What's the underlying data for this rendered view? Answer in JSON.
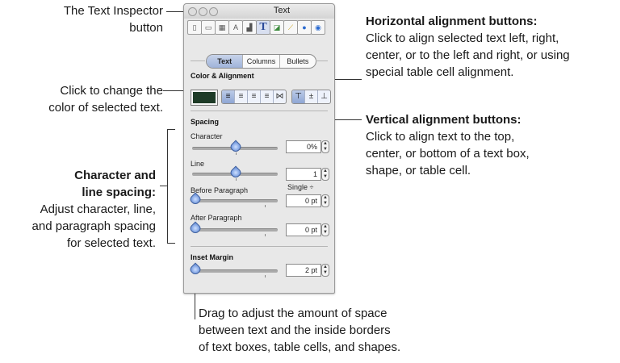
{
  "annotations": {
    "inspector_button": [
      "The Text Inspector",
      "button"
    ],
    "color": [
      "Click to change the",
      "color of selected text."
    ],
    "spacing_heading": [
      "Character and",
      "line spacing:"
    ],
    "spacing_body": [
      "Adjust character, line,",
      "and paragraph spacing",
      "for selected text."
    ],
    "horizontal_heading": "Horizontal alignment buttons:",
    "horizontal_body": [
      "Click to align selected text left, right,",
      "center, or to the left and right, or using",
      "special table cell alignment."
    ],
    "vertical_heading": "Vertical alignment buttons:",
    "vertical_body": [
      "Click to align text to the top,",
      "center, or bottom of a text box,",
      "shape, or table cell."
    ],
    "inset_body": [
      "Drag to adjust the amount of space",
      "between text and the inside borders",
      "of text boxes, table cells, and shapes."
    ]
  },
  "panel": {
    "title": "Text",
    "tabs": [
      "Text",
      "Columns",
      "Bullets"
    ],
    "color_alignment_label": "Color & Alignment",
    "text_color": "#1e3b27",
    "horizontal_buttons": [
      "≡",
      "≡",
      "≡",
      "≡",
      "⋈"
    ],
    "vertical_buttons": [
      "⊤",
      "±",
      "⊥"
    ],
    "spacing_label": "Spacing",
    "character_label": "Character",
    "character_value": "0%",
    "line_label": "Line",
    "line_value": "1",
    "line_mode": "Single ÷",
    "before_label": "Before Paragraph",
    "before_value": "0 pt",
    "after_label": "After Paragraph",
    "after_value": "0 pt",
    "inset_label": "Inset Margin",
    "inset_value": "2 pt",
    "toolbar_icons": [
      "document-icon",
      "layout-icon",
      "table-icon",
      "ai-icon",
      "chart-icon",
      "text-icon",
      "graphic-icon",
      "ruler-icon",
      "link-icon",
      "quicktime-icon"
    ]
  }
}
